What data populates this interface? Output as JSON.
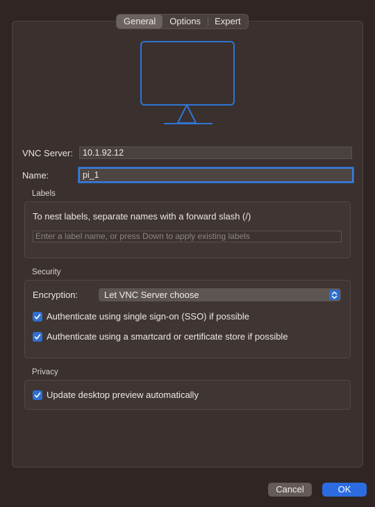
{
  "tabs": [
    {
      "label": "General",
      "active": true
    },
    {
      "label": "Options",
      "active": false
    },
    {
      "label": "Expert",
      "active": false
    }
  ],
  "preview_icon": "monitor-icon",
  "vnc_server": {
    "label": "VNC Server:",
    "value": "10.1.92.12"
  },
  "name": {
    "label": "Name:",
    "value": "pi_1"
  },
  "labels_section": {
    "title": "Labels",
    "hint": "To nest labels, separate names with a forward slash (/)",
    "placeholder": "Enter a label name, or press Down to apply existing labels"
  },
  "security_section": {
    "title": "Security",
    "encryption_label": "Encryption:",
    "encryption_value": "Let VNC Server choose",
    "options": [
      {
        "label": "Authenticate using single sign-on (SSO) if possible",
        "checked": true
      },
      {
        "label": "Authenticate using a smartcard or certificate store if possible",
        "checked": true
      }
    ]
  },
  "privacy_section": {
    "title": "Privacy",
    "options": [
      {
        "label": "Update desktop preview automatically",
        "checked": true
      }
    ]
  },
  "buttons": {
    "cancel": "Cancel",
    "ok": "OK"
  },
  "colors": {
    "accent": "#2f6fcf",
    "focus": "#3a7ddb",
    "icon_stroke": "#2f75d6",
    "background": "#2f2624"
  }
}
